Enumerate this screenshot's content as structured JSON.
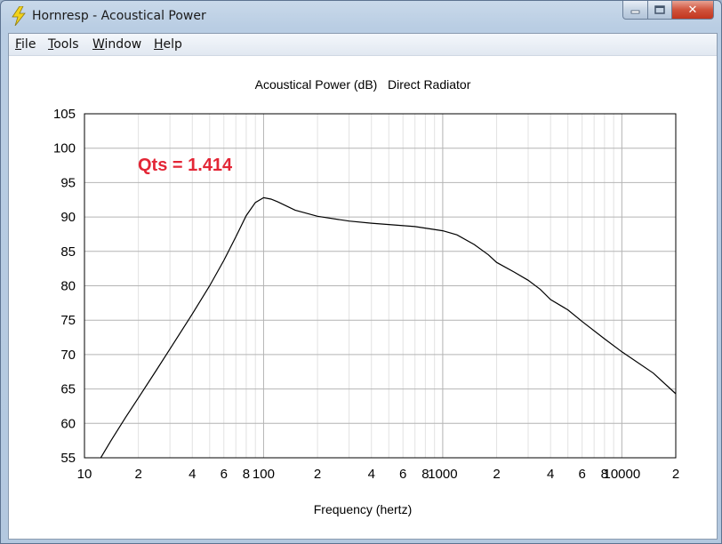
{
  "window": {
    "title": "Hornresp - Acoustical Power",
    "close_glyph": "✕"
  },
  "menu": [
    {
      "label": "File"
    },
    {
      "label": "Tools"
    },
    {
      "label": "Window"
    },
    {
      "label": "Help"
    }
  ],
  "annotation": {
    "text": "Qts = 1.414",
    "color": "#e32636"
  },
  "chart_data": {
    "type": "line",
    "title": "Acoustical Power (dB)   Direct Radiator",
    "xlabel": "Frequency (hertz)",
    "ylabel": "",
    "x_scale": "log",
    "xlim": [
      10,
      20000
    ],
    "ylim": [
      55,
      105
    ],
    "grid": true,
    "y_ticks": [
      55,
      60,
      65,
      70,
      75,
      80,
      85,
      90,
      95,
      100,
      105
    ],
    "x_ticks": [
      {
        "value": 10,
        "label": "10"
      },
      {
        "value": 20,
        "label": "2"
      },
      {
        "value": 40,
        "label": "4"
      },
      {
        "value": 60,
        "label": "6"
      },
      {
        "value": 80,
        "label": "8"
      },
      {
        "value": 100,
        "label": "100"
      },
      {
        "value": 200,
        "label": "2"
      },
      {
        "value": 400,
        "label": "4"
      },
      {
        "value": 600,
        "label": "6"
      },
      {
        "value": 800,
        "label": "8"
      },
      {
        "value": 1000,
        "label": "1000"
      },
      {
        "value": 2000,
        "label": "2"
      },
      {
        "value": 4000,
        "label": "4"
      },
      {
        "value": 6000,
        "label": "6"
      },
      {
        "value": 8000,
        "label": "8"
      },
      {
        "value": 10000,
        "label": "10000"
      },
      {
        "value": 20000,
        "label": "2"
      }
    ],
    "series": [
      {
        "color": "#000000",
        "x": [
          12,
          14,
          17,
          20,
          25,
          30,
          40,
          50,
          60,
          70,
          80,
          90,
          100,
          110,
          120,
          150,
          200,
          300,
          400,
          500,
          700,
          1000,
          1200,
          1500,
          1800,
          2000,
          2500,
          3000,
          3500,
          4000,
          5000,
          6000,
          8000,
          10000,
          15000,
          20000
        ],
        "y": [
          54.5,
          57.4,
          60.9,
          63.7,
          67.6,
          70.8,
          75.9,
          80.0,
          83.7,
          87.1,
          90.2,
          92.1,
          92.8,
          92.6,
          92.2,
          91.0,
          90.1,
          89.4,
          89.1,
          88.9,
          88.6,
          88.0,
          87.4,
          86.0,
          84.5,
          83.4,
          82.0,
          80.8,
          79.5,
          78.0,
          76.5,
          74.8,
          72.3,
          70.4,
          67.3,
          64.3
        ]
      }
    ]
  }
}
